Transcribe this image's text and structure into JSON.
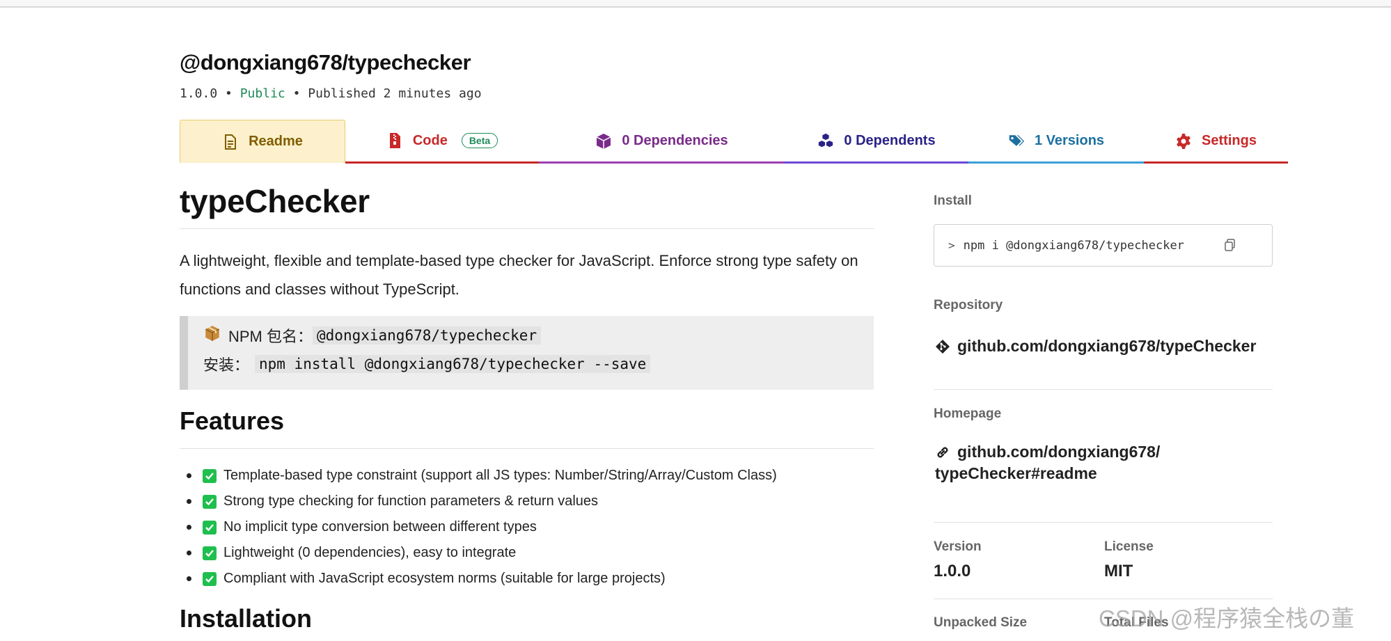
{
  "package": {
    "name": "@dongxiang678/typechecker",
    "version": "1.0.0",
    "sep1": "•",
    "visibility": "Public",
    "sep2": "•",
    "published": "Published 2 minutes ago"
  },
  "tabs": {
    "readme": "Readme",
    "code": "Code",
    "code_badge": "Beta",
    "dependencies": "0 Dependencies",
    "dependents": "0 Dependents",
    "versions": "1 Versions",
    "settings": "Settings"
  },
  "readme": {
    "title": "typeChecker",
    "description": "A lightweight, flexible and template-based type checker for JavaScript. Enforce strong type safety on functions and classes without TypeScript.",
    "quote": {
      "line1_label": "NPM 包名：",
      "line1_code": "@dongxiang678/typechecker",
      "line2_label": "安装：",
      "line2_code": "npm install @dongxiang678/typechecker --save"
    },
    "features_heading": "Features",
    "features": [
      "Template-based type constraint (support all JS types: Number/String/Array/Custom Class)",
      "Strong type checking for function parameters & return values",
      "No implicit type conversion between different types",
      "Lightweight (0 dependencies), easy to integrate",
      "Compliant with JavaScript ecosystem norms (suitable for large projects)"
    ],
    "installation_heading": "Installation"
  },
  "sidebar": {
    "install_label": "Install",
    "install_command": "npm i @dongxiang678/typechecker",
    "repository_label": "Repository",
    "repository_link": "github.com/dongxiang678/typeChecker",
    "homepage_label": "Homepage",
    "homepage_link_line1": "github.com/dongxiang678/",
    "homepage_link_line2": "typeChecker#readme",
    "version_label": "Version",
    "version_value": "1.0.0",
    "license_label": "License",
    "license_value": "MIT",
    "unpacked_size_label": "Unpacked Size",
    "total_files_label": "Total Files"
  },
  "watermark": "CSDN @程序猿全栈の董",
  "colors": {
    "readme_tab_bg": "#fcf1cc",
    "code_red": "#c82828",
    "deps_purple": "#7a2a8a",
    "dependents_indigo": "#2a2288",
    "versions_blue": "#1c70a0",
    "public_green": "#1e8a5a",
    "check_green": "#1fbf4e"
  },
  "icons": {
    "readme": "document-icon",
    "code": "zip-file-icon",
    "dependencies": "cube-icon",
    "dependents": "cubes-icon",
    "versions": "tags-icon",
    "settings": "gear-icon",
    "copy": "copy-icon",
    "repository": "git-icon",
    "homepage": "link-icon",
    "feature": "check-box-icon",
    "package_emoji": "package-emoji-icon"
  }
}
